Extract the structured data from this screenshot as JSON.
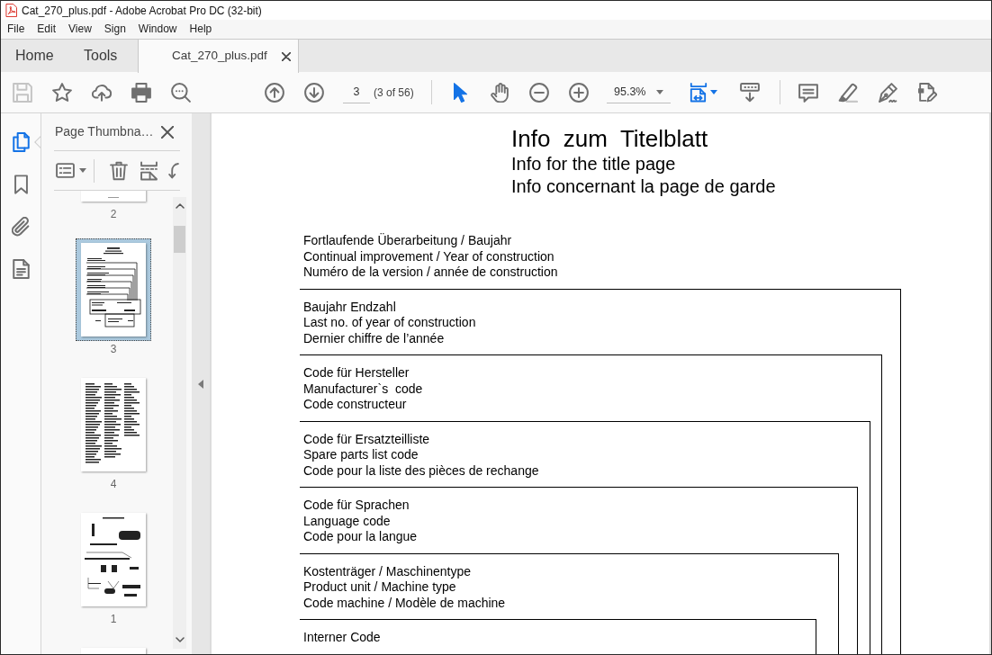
{
  "window": {
    "title": "Cat_270_plus.pdf - Adobe Acrobat Pro DC (32-bit)"
  },
  "menu": [
    "File",
    "Edit",
    "View",
    "Sign",
    "Window",
    "Help"
  ],
  "tabs": [
    {
      "label": "Home",
      "kind": "nav",
      "selected": false
    },
    {
      "label": "Tools",
      "kind": "nav",
      "selected": false
    },
    {
      "label": "Cat_270_plus.pdf",
      "kind": "document",
      "selected": true
    }
  ],
  "toolbar": {
    "file_buttons": [
      {
        "kind": "save",
        "disabled": true
      },
      {
        "kind": "star",
        "disabled": false
      },
      {
        "kind": "upload",
        "disabled": false
      },
      {
        "kind": "print",
        "disabled": false
      },
      {
        "kind": "find",
        "disabled": false
      }
    ],
    "page_buttons": [
      {
        "kind": "up"
      },
      {
        "kind": "down"
      }
    ],
    "page_field": "3",
    "page_count": "(3 of 56)",
    "pointer_tools": [
      {
        "kind": "select",
        "selected": true
      },
      {
        "kind": "hand",
        "selected": false
      }
    ],
    "zoom_buttons": [
      {
        "kind": "minus"
      },
      {
        "kind": "plus"
      }
    ],
    "zoom_field": "95.3%",
    "view_buttons": [
      {
        "kind": "fit",
        "on": true
      },
      {
        "kind": "scroll",
        "on": false
      }
    ],
    "comment_tools": [
      {
        "kind": "comment"
      },
      {
        "kind": "highlight"
      },
      {
        "kind": "sign"
      },
      {
        "kind": "edit"
      }
    ]
  },
  "rail": [
    {
      "kind": "pages",
      "selected": true
    },
    {
      "kind": "bookmarks",
      "selected": false
    },
    {
      "kind": "attachments",
      "selected": false
    },
    {
      "kind": "document",
      "selected": false
    }
  ],
  "panel": {
    "title": "Page Thumbna…",
    "tools": [
      {
        "kind": "options"
      },
      {
        "kind": "delete"
      },
      {
        "kind": "insert"
      },
      {
        "kind": "rotate"
      }
    ],
    "thumbnails": [
      {
        "label": "2",
        "kind": "plain",
        "selected": false
      },
      {
        "label": "3",
        "kind": "form",
        "selected": true
      },
      {
        "label": "4",
        "kind": "list",
        "selected": false
      },
      {
        "label": "1",
        "kind": "diagram",
        "selected": false
      },
      {
        "kind": "plain",
        "selected": false
      }
    ]
  },
  "document": {
    "title": "Info  zum  Titelblatt",
    "subtitles": [
      "Info for the title page",
      "Info concernant la page de garde"
    ],
    "intro": [
      "Fortlaufende Überarbeitung / Baujahr",
      "Continual improvement / Year of construction",
      "Numéro de la version / année de construction"
    ],
    "sections": [
      {
        "lines": [
          "Baujahr Endzahl",
          "Last no. of year of construction",
          "Dernier chiffre de l’année"
        ]
      },
      {
        "lines": [
          "Code für Hersteller",
          "Manufacturer`s  code",
          "Code constructeur"
        ]
      },
      {
        "lines": [
          "Code für Ersatzteilliste",
          "Spare parts list code",
          "Code pour la liste des pièces de rechange"
        ]
      },
      {
        "lines": [
          "Code für Sprachen",
          "Language code",
          "Code pour la langue"
        ]
      },
      {
        "lines": [
          "Kostenträger / Maschinentype",
          "Product unit / Machine type",
          "Code machine / Modèle de machine"
        ]
      },
      {
        "lines": [
          "Interner Code"
        ]
      }
    ]
  }
}
